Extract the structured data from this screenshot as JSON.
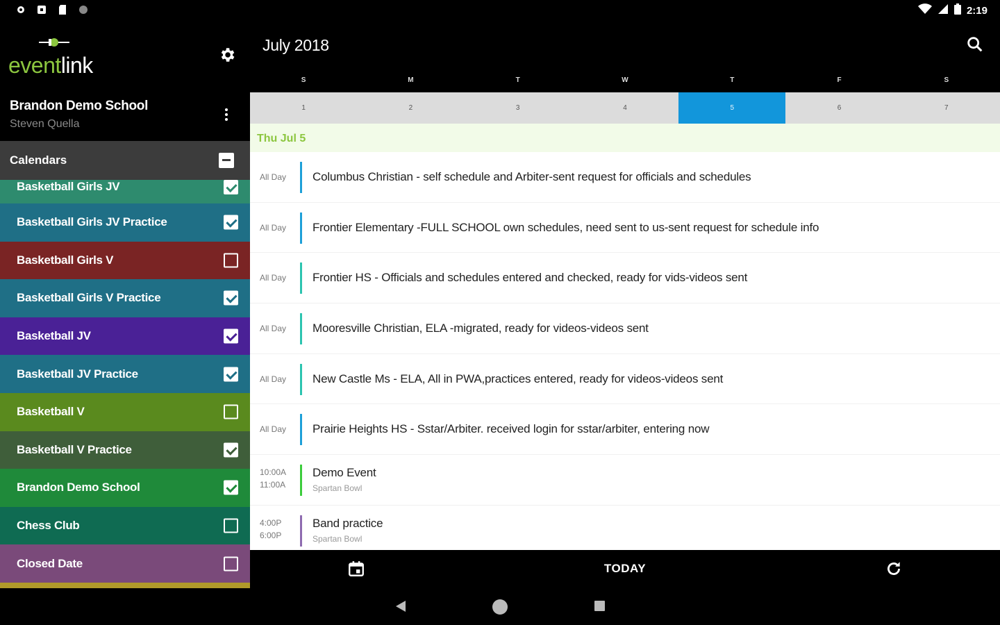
{
  "status": {
    "time": "2:19"
  },
  "sidebar": {
    "brand": {
      "logo_green": "event",
      "logo_white": "link"
    },
    "account": {
      "school": "Brandon Demo School",
      "user": "Steven Quella"
    },
    "calendars_label": "Calendars",
    "calendars": [
      {
        "label": "Basketball Girls JV",
        "color": "#2e8b6e",
        "checked": true,
        "partial": true
      },
      {
        "label": "Basketball Girls JV Practice",
        "color": "#1f6f86",
        "checked": true
      },
      {
        "label": "Basketball Girls V",
        "color": "#7a2424",
        "checked": false
      },
      {
        "label": "Basketball Girls V Practice",
        "color": "#1f6f86",
        "checked": true
      },
      {
        "label": "Basketball JV",
        "color": "#4a2196",
        "checked": true
      },
      {
        "label": "Basketball JV Practice",
        "color": "#1f6f86",
        "checked": true
      },
      {
        "label": "Basketball V",
        "color": "#5a8a1e",
        "checked": false
      },
      {
        "label": "Basketball V Practice",
        "color": "#3f5e3a",
        "checked": true
      },
      {
        "label": "Brandon Demo School",
        "color": "#1f8a3a",
        "checked": true
      },
      {
        "label": "Chess Club",
        "color": "#0f6b52",
        "checked": false
      },
      {
        "label": "Closed Date",
        "color": "#7a4a7a",
        "checked": false
      }
    ]
  },
  "main": {
    "month_title": "July 2018",
    "weekdays": [
      "S",
      "M",
      "T",
      "W",
      "T",
      "F",
      "S"
    ],
    "week_days": [
      "1",
      "2",
      "3",
      "4",
      "5",
      "6",
      "7"
    ],
    "selected_index": 4,
    "day_header": "Thu Jul 5",
    "events": [
      {
        "type": "allday",
        "time": "All Day",
        "title": "Columbus Christian - self schedule and Arbiter-sent request for officials and schedules",
        "color": "#1ea0d8"
      },
      {
        "type": "allday",
        "time": "All Day",
        "title": "Frontier Elementary -FULL SCHOOL own schedules, need sent to us-sent request for schedule info",
        "color": "#1ea0d8"
      },
      {
        "type": "allday",
        "time": "All Day",
        "title": "Frontier HS - Officials and schedules entered and checked, ready for vids-videos sent",
        "color": "#2cc4b0"
      },
      {
        "type": "allday",
        "time": "All Day",
        "title": "Mooresville Christian, ELA -migrated, ready for videos-videos sent",
        "color": "#2cc4b0"
      },
      {
        "type": "allday",
        "time": "All Day",
        "title": "New Castle Ms - ELA, All in PWA,practices entered, ready for videos-videos sent",
        "color": "#2cc4b0"
      },
      {
        "type": "allday",
        "time": "All Day",
        "title": "Prairie Heights HS - Sstar/Arbiter. received login for sstar/arbiter, entering now",
        "color": "#1ea0d8"
      },
      {
        "type": "timed",
        "start": "10:00A",
        "end": "11:00A",
        "title": "Demo Event",
        "location": "Spartan Bowl",
        "color": "#3ccc3c"
      },
      {
        "type": "timed",
        "start": "4:00P",
        "end": "6:00P",
        "title": "Band practice",
        "location": "Spartan Bowl",
        "color": "#8e6bb0"
      }
    ]
  },
  "bottombar": {
    "today_label": "TODAY"
  }
}
